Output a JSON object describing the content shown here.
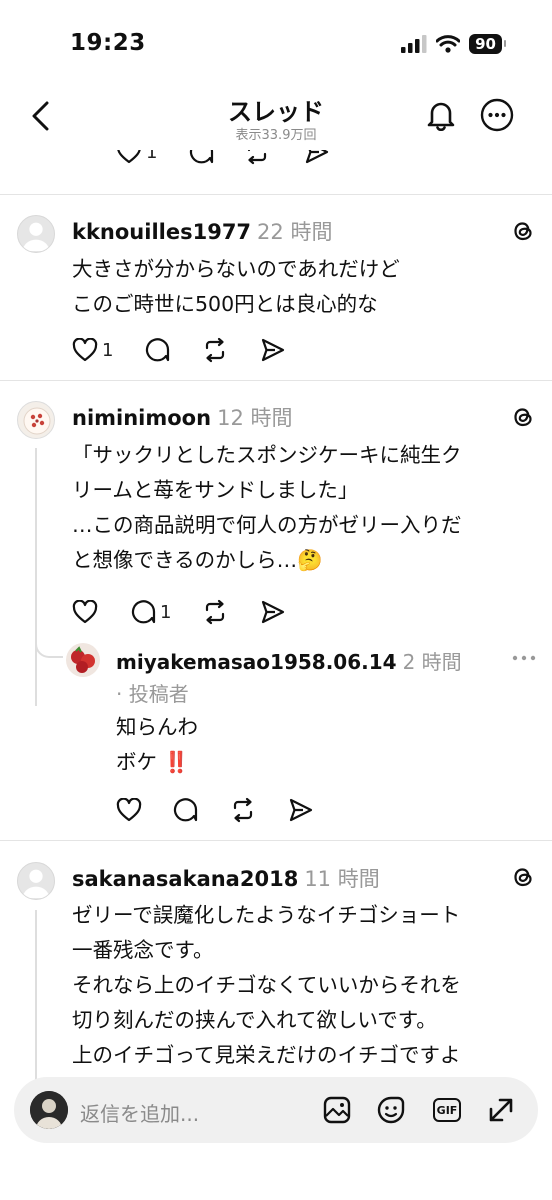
{
  "status": {
    "time": "19:23",
    "battery": "90"
  },
  "header": {
    "title": "スレッド",
    "subtitle": "表示33.9万回"
  },
  "prev_post": {
    "like_count": "1"
  },
  "posts": [
    {
      "username": "kknouilles1977",
      "time": "22 時間",
      "lines": [
        "大きさが分からないのであれだけど",
        "このご時世に500円とは良心的な"
      ],
      "like_count": "1",
      "reply_count": ""
    },
    {
      "username": "niminimoon",
      "time": "12 時間",
      "lines": [
        "「サックリとしたスポンジケーキに純生ク",
        "リームと苺をサンドしました」",
        "…この商品説明で何人の方がゼリー入りだ",
        "と想像できるのかしら…🤔"
      ],
      "like_count": "",
      "reply_count": "1"
    },
    {
      "username": "sakanasakana2018",
      "time": "11 時間",
      "lines": [
        "ゼリーで誤魔化したようなイチゴショート",
        "一番残念です。",
        "それなら上のイチゴなくていいからそれを",
        "切り刻んだの挟んで入れて欲しいです。",
        "上のイチゴって見栄えだけのイチゴですよ"
      ]
    }
  ],
  "reply": {
    "username": "miyakemasao1958.06.14",
    "time": "2 時間",
    "author_tag": "· 投稿者",
    "lines": [
      "知らんわ",
      "ボケ ‼️"
    ]
  },
  "reply_bar": {
    "placeholder": "返信を追加...",
    "gif_label": "GIF"
  }
}
